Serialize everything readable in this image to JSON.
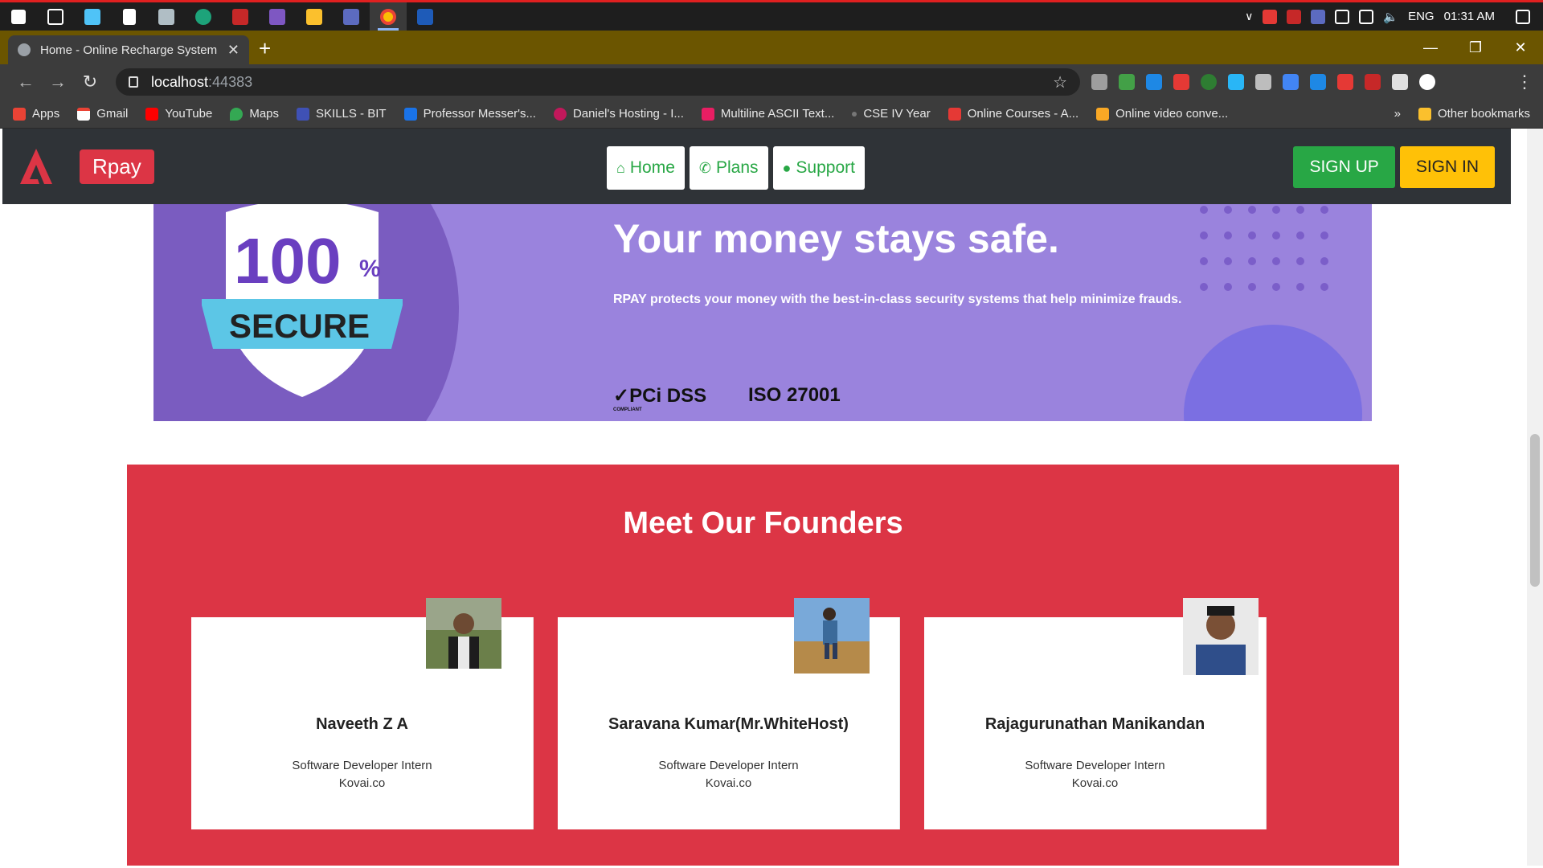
{
  "taskbar": {
    "tray": {
      "language": "ENG",
      "time": "01:31 AM"
    }
  },
  "browser": {
    "tab_title": "Home - Online Recharge System",
    "url_host": "localhost",
    "url_port": ":44383",
    "bookmarks": [
      {
        "label": "Apps",
        "color": "#ea4335"
      },
      {
        "label": "Gmail",
        "color": "#ea4335"
      },
      {
        "label": "YouTube",
        "color": "#ff0000"
      },
      {
        "label": "Maps",
        "color": "#34a853"
      },
      {
        "label": "SKILLS - BIT",
        "color": "#3f51b5"
      },
      {
        "label": "Professor Messer's...",
        "color": "#1a73e8"
      },
      {
        "label": "Daniel's Hosting - I...",
        "color": "#c2185b"
      },
      {
        "label": "Multiline ASCII Text...",
        "color": "#e91e63"
      },
      {
        "label": "CSE IV Year",
        "color": "#777777"
      },
      {
        "label": "Online Courses - A...",
        "color": "#e53935"
      },
      {
        "label": "Online video conve...",
        "color": "#f9a825"
      }
    ],
    "bookmarks_more": "»",
    "other_bookmarks": "Other bookmarks"
  },
  "site": {
    "brand": "Rpay",
    "nav": [
      {
        "label": "Home",
        "icon": "home-icon"
      },
      {
        "label": "Plans",
        "icon": "phone-icon"
      },
      {
        "label": "Support",
        "icon": "chat-icon"
      }
    ],
    "signup": "SIGN UP",
    "signin": "SIGN IN"
  },
  "banner": {
    "badge_number": "100",
    "badge_percent": "%",
    "badge_word": "SECURE",
    "title": "Your money stays safe.",
    "subtitle": "RPAY protects your money with the best-in-class security systems that help minimize frauds.",
    "cert1": "✓PCi DSS",
    "cert1_small": "COMPLIANT",
    "cert2": "ISO 27001"
  },
  "founders": {
    "title": "Meet Our Founders",
    "people": [
      {
        "name": "Naveeth Z A",
        "role": "Software Developer Intern",
        "company": "Kovai.co"
      },
      {
        "name": "Saravana Kumar(Mr.WhiteHost)",
        "role": "Software Developer Intern",
        "company": "Kovai.co"
      },
      {
        "name": "Rajagurunathan Manikandan",
        "role": "Software Developer Intern",
        "company": "Kovai.co"
      }
    ]
  },
  "colors": {
    "accent_red": "#dc3545",
    "success_green": "#28a745",
    "warning_yellow": "#ffc107",
    "banner_purple": "#9a83dd"
  }
}
